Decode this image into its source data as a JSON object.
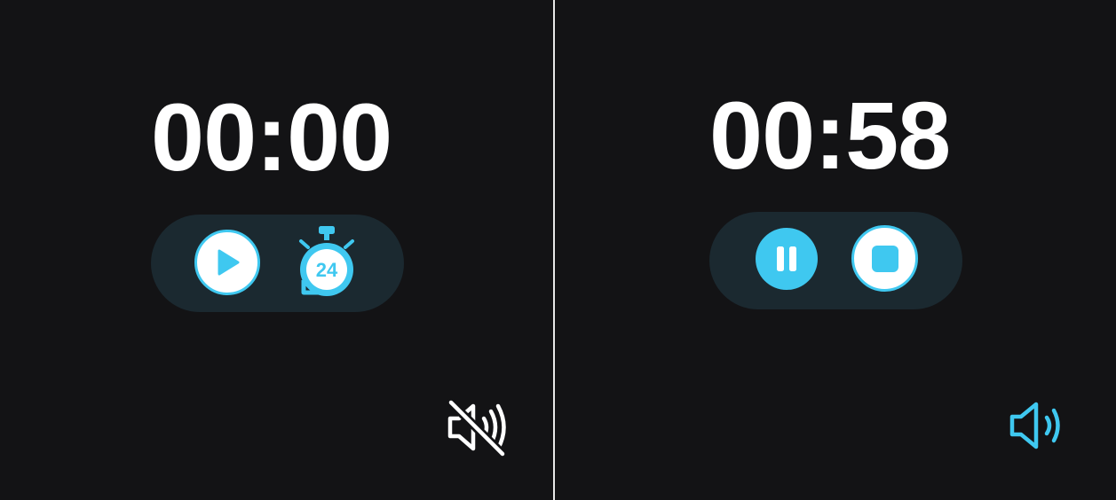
{
  "screens": [
    {
      "id": "idle",
      "time_display": "00:00",
      "controls": [
        {
          "name": "play-button",
          "icon": "play-icon"
        },
        {
          "name": "timer-24-button",
          "icon": "stopwatch-24-icon",
          "label": "24"
        }
      ],
      "sound": {
        "state": "muted",
        "icon": "speaker-muted-icon",
        "color": "#ffffff"
      }
    },
    {
      "id": "running",
      "time_display": "00:58",
      "controls": [
        {
          "name": "pause-button",
          "icon": "pause-icon"
        },
        {
          "name": "stop-button",
          "icon": "stop-icon"
        }
      ],
      "sound": {
        "state": "on",
        "icon": "speaker-on-icon",
        "color": "#3fc8f0"
      }
    }
  ],
  "colors": {
    "background": "#131315",
    "pill": "#1b2930",
    "accent": "#3fc8f0",
    "text": "#ffffff",
    "divider": "#e8e8e8"
  }
}
